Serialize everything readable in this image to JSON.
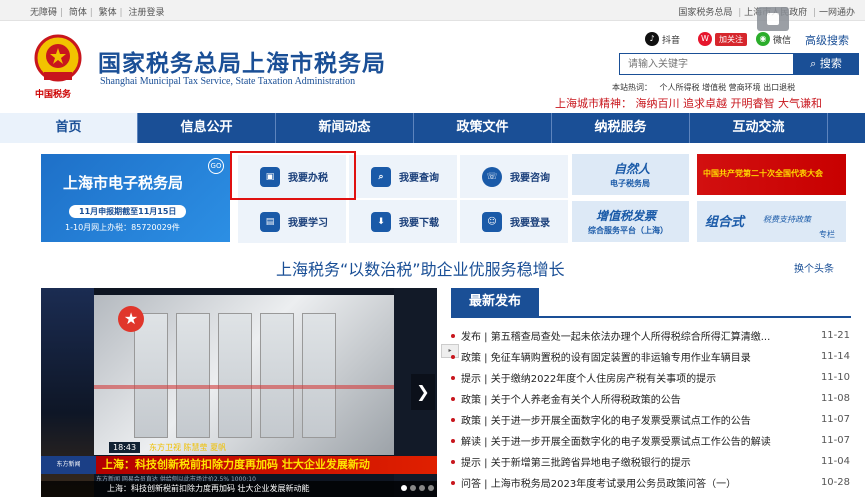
{
  "topbar": {
    "left": [
      "无障碍",
      "简体",
      "繁体",
      "注册登录"
    ],
    "right": [
      "国家税务总局",
      "上海市人民政府",
      "一网通办"
    ],
    "sep": "|"
  },
  "header": {
    "title_cn": "国家税务总局上海市税务局",
    "title_en": "Shanghai Municipal Tax Service, State Taxation Administration",
    "logo_caption": "中国税务"
  },
  "social": {
    "douyin": "抖音",
    "weibo": "加关注",
    "wechat": "微信",
    "advanced_search": "高级搜索"
  },
  "search": {
    "placeholder": "请输入关键字",
    "button": "搜索",
    "hot_label": "本站热词：",
    "hot_words": [
      "个人所得税",
      "增值税",
      "营商环境",
      "出口退税"
    ]
  },
  "spirit": "上海城市精神： 海纳百川 追求卓越 开明睿智 大气谦和",
  "nav": [
    "首页",
    "信息公开",
    "新闻动态",
    "政策文件",
    "纳税服务",
    "互动交流"
  ],
  "etax": {
    "title": "上海市电子税务局",
    "deadline": "11月申报期截至11月15日",
    "stat": "1-10月网上办税：85720029件",
    "badge": "GO"
  },
  "services": [
    "我要办税",
    "我要查询",
    "我要咨询",
    "我要学习",
    "我要下载",
    "我要登录"
  ],
  "promos": {
    "p1_title": "自然人",
    "p1_sub": "电子税务局",
    "p2_title": "中国共产党第二十次全国代表大会",
    "p3_title": "增值税发票",
    "p3_sub": "综合服务平台（上海）",
    "p4_title": "组合式",
    "p4_sub": "税费支持政策",
    "p4_tag": "专栏"
  },
  "headline": "上海税务“以数治税”助企业优服务稳增长",
  "swap": "换个头条",
  "video": {
    "time_tag": "18:43",
    "channel": "东方卫视 陈慧莹 夏帆",
    "caption": "上海：科技创新税前扣除力度再加码 壮大企业发展新动",
    "left_tag": "东方新闻",
    "ticker": "东方新闻 网易会员直达 供给侧以此市场计价2.5% 1000:10",
    "bottom": "上海：科技创新税前扣除力度再加码 壮大企业发展新动能",
    "next": "❯",
    "logo": "★"
  },
  "news": {
    "tab": "最新发布",
    "items": [
      {
        "text": "发布 | 第五稽查局查处一起未依法办理个人所得税综合所得汇算清缴...",
        "date": "11-21"
      },
      {
        "text": "政策 | 免征车辆购置税的设有固定装置的非运输专用作业车辆目录",
        "date": "11-14"
      },
      {
        "text": "提示 | 关于缴纳2022年度个人住房房产税有关事项的提示",
        "date": "11-10"
      },
      {
        "text": "政策 | 关于个人养老金有关个人所得税政策的公告",
        "date": "11-08"
      },
      {
        "text": "政策 | 关于进一步开展全面数字化的电子发票受票试点工作的公告",
        "date": "11-07"
      },
      {
        "text": "解读 | 关于进一步开展全面数字化的电子发票受票试点工作公告的解读",
        "date": "11-07"
      },
      {
        "text": "提示 | 关于新增第三批跨省异地电子缴税银行的提示",
        "date": "11-04"
      },
      {
        "text": "问答 | 上海市税务局2023年度考试录用公务员政策问答（一）",
        "date": "10-28"
      }
    ]
  },
  "colors": {
    "brand": "#1a4f96",
    "accent": "#c8161d"
  }
}
